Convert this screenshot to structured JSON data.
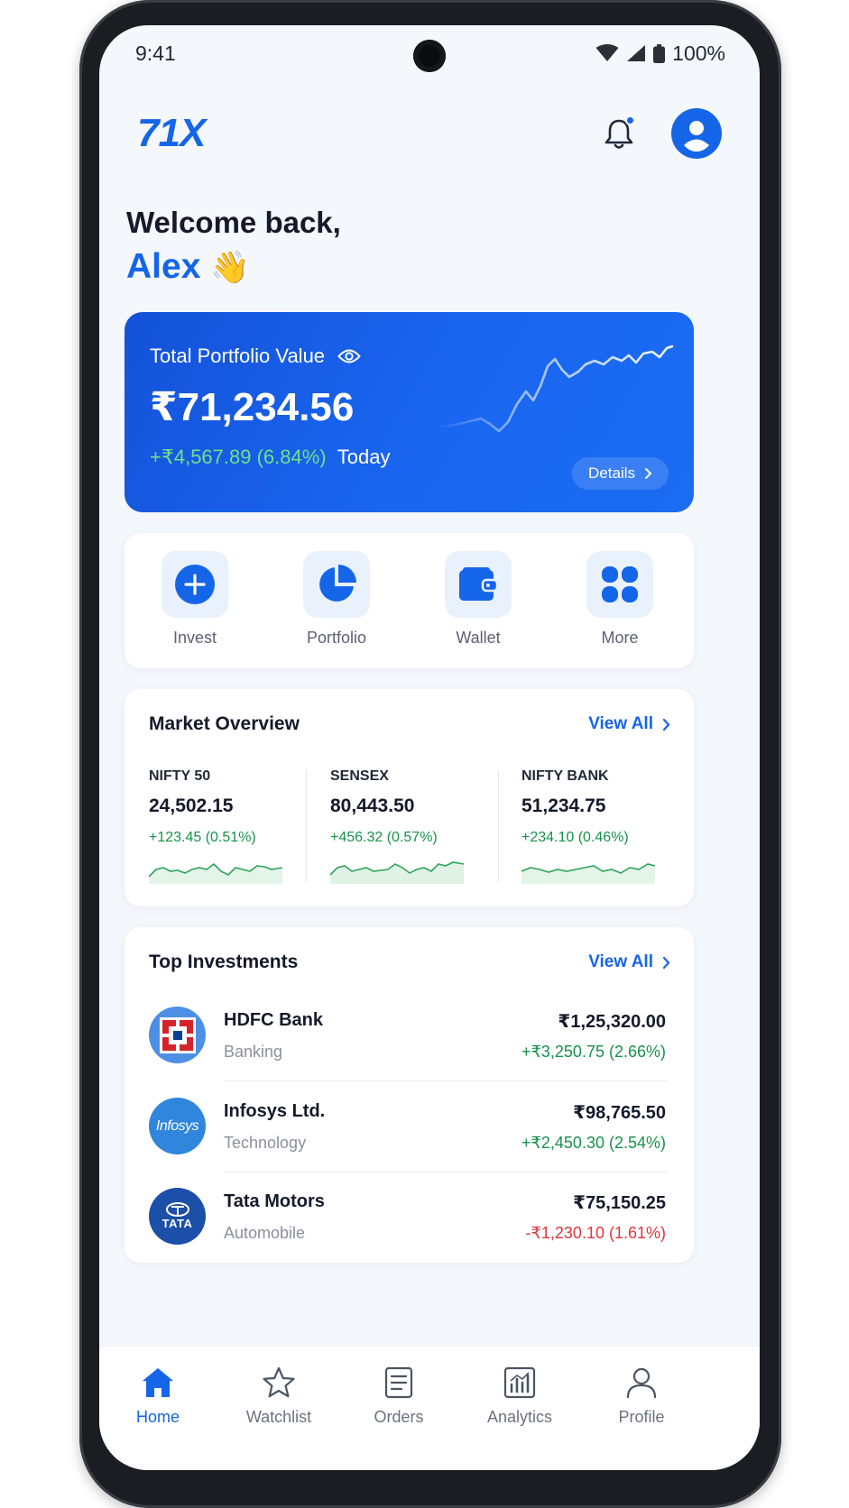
{
  "status_bar": {
    "time": "9:41",
    "battery": "100%"
  },
  "header": {
    "logo": "71X"
  },
  "greeting": {
    "welcome": "Welcome back,",
    "name": "Alex",
    "emoji": "👋"
  },
  "portfolio": {
    "label": "Total Portfolio Value",
    "value": "₹71,234.56",
    "change": "+₹4,567.89 (6.84%)",
    "period": "Today",
    "details_label": "Details"
  },
  "quick_actions": [
    {
      "label": "Invest",
      "icon": "plus-circle-icon"
    },
    {
      "label": "Portfolio",
      "icon": "pie-chart-icon"
    },
    {
      "label": "Wallet",
      "icon": "wallet-icon"
    },
    {
      "label": "More",
      "icon": "grid-icon"
    }
  ],
  "market": {
    "title": "Market Overview",
    "view_all": "View All",
    "indices": [
      {
        "name": "NIFTY 50",
        "value": "24,502.15",
        "change": "+123.45 (0.51%)"
      },
      {
        "name": "SENSEX",
        "value": "80,443.50",
        "change": "+456.32 (0.57%)"
      },
      {
        "name": "NIFTY BANK",
        "value": "51,234.75",
        "change": "+234.10 (0.46%)"
      }
    ]
  },
  "investments": {
    "title": "Top Investments",
    "view_all": "View All",
    "items": [
      {
        "name": "HDFC Bank",
        "sector": "Banking",
        "amount": "₹1,25,320.00",
        "change": "+₹3,250.75 (2.66%)",
        "direction": "up"
      },
      {
        "name": "Infosys Ltd.",
        "sector": "Technology",
        "amount": "₹98,765.50",
        "change": "+₹2,450.30 (2.54%)",
        "direction": "up",
        "logo_text": "Infosys"
      },
      {
        "name": "Tata Motors",
        "sector": "Automobile",
        "amount": "₹75,150.25",
        "change": "-₹1,230.10 (1.61%)",
        "direction": "down",
        "logo_text": "TATA"
      }
    ]
  },
  "nav": [
    {
      "label": "Home",
      "icon": "home-icon",
      "active": true
    },
    {
      "label": "Watchlist",
      "icon": "star-icon",
      "active": false
    },
    {
      "label": "Orders",
      "icon": "orders-icon",
      "active": false
    },
    {
      "label": "Analytics",
      "icon": "analytics-icon",
      "active": false
    },
    {
      "label": "Profile",
      "icon": "profile-icon",
      "active": false
    }
  ],
  "colors": {
    "accent": "#1565e8",
    "gain": "#17924a",
    "loss": "#e0363b",
    "background": "#f4f7fc"
  }
}
